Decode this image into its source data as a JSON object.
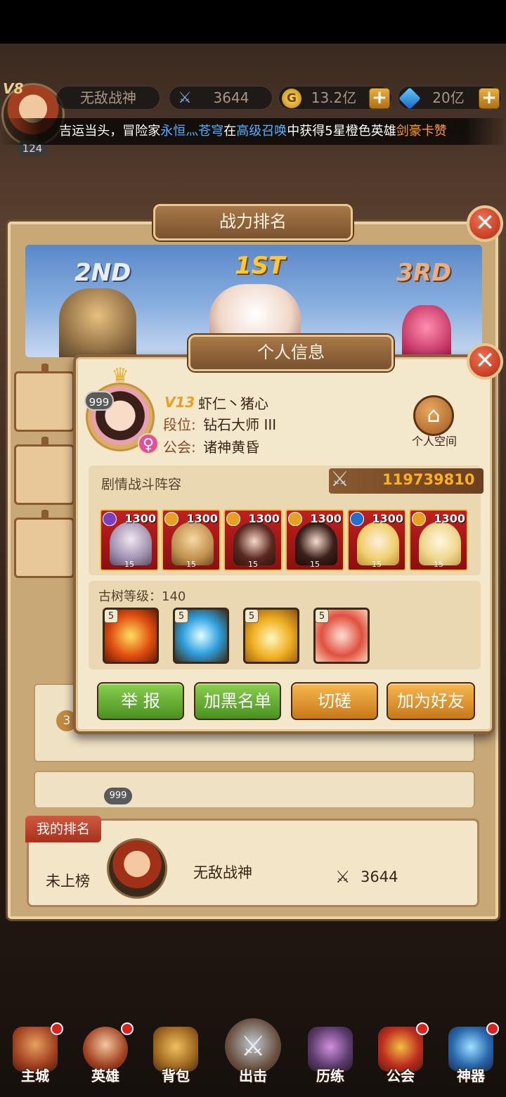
{
  "hud": {
    "vip": "V8",
    "level": "124",
    "player_name": "无敌战神",
    "power": "3644",
    "gold": "13.2亿",
    "gems": "20亿",
    "plus": "+"
  },
  "announcement": {
    "part1": "吉运当头，冒险家",
    "player": "永恒灬苍穹",
    "part2": "在",
    "source": "高级召唤",
    "part3": "中获得5星橙色英雄",
    "hero": "剑豪卡赞"
  },
  "ranking_panel": {
    "title": "战力排名",
    "close": "✕",
    "podium": {
      "first": "1ST",
      "second": "2ND",
      "third": "3RD"
    }
  },
  "my_rank": {
    "tag": "我的排名",
    "status": "未上榜",
    "name": "无敌战神",
    "power": "3644"
  },
  "info_modal": {
    "title": "个人信息",
    "close": "✕",
    "badge": "999",
    "vip": "V13",
    "name": "虾仁丶猪心",
    "rank_label": "段位:",
    "rank_value": "钻石大师 III",
    "guild_label": "公会:",
    "guild_value": "诸神黄昏",
    "home_label": "个人空间",
    "team_title": "剧情战斗阵容",
    "team_power": "119739810",
    "heroes": [
      {
        "level": "1300",
        "stars": "15",
        "element_color": "#7a40c0"
      },
      {
        "level": "1300",
        "stars": "15",
        "element_color": "#e8a020"
      },
      {
        "level": "1300",
        "stars": "15",
        "element_color": "#e8a020"
      },
      {
        "level": "1300",
        "stars": "15",
        "element_color": "#e8a020"
      },
      {
        "level": "1300",
        "stars": "15",
        "element_color": "#2070d0"
      },
      {
        "level": "1300",
        "stars": "15",
        "element_color": "#e8a020"
      }
    ],
    "tree_label": "古树等级：140",
    "relics": [
      {
        "level": "5"
      },
      {
        "level": "5"
      },
      {
        "level": "5"
      },
      {
        "level": "5"
      }
    ],
    "buttons": {
      "report": "举 报",
      "blacklist": "加黑名单",
      "duel": "切磋",
      "add_friend": "加为好友"
    }
  },
  "other_rows": {
    "row4_badge": "999",
    "row3_badge": "3"
  },
  "nav": [
    {
      "label": "主城",
      "icon": "castle-icon"
    },
    {
      "label": "英雄",
      "icon": "hero-icon"
    },
    {
      "label": "背包",
      "icon": "backpack-icon"
    },
    {
      "label": "出击",
      "icon": "swords-icon"
    },
    {
      "label": "历练",
      "icon": "training-icon"
    },
    {
      "label": "公会",
      "icon": "guild-icon"
    },
    {
      "label": "神器",
      "icon": "artifact-icon"
    }
  ],
  "colors": {
    "accent_gold": "#ffb020",
    "announce_blue": "#4fb0ff",
    "announce_orange": "#ff9a20",
    "button_green": "#6ab038",
    "button_orange": "#e89a30"
  }
}
